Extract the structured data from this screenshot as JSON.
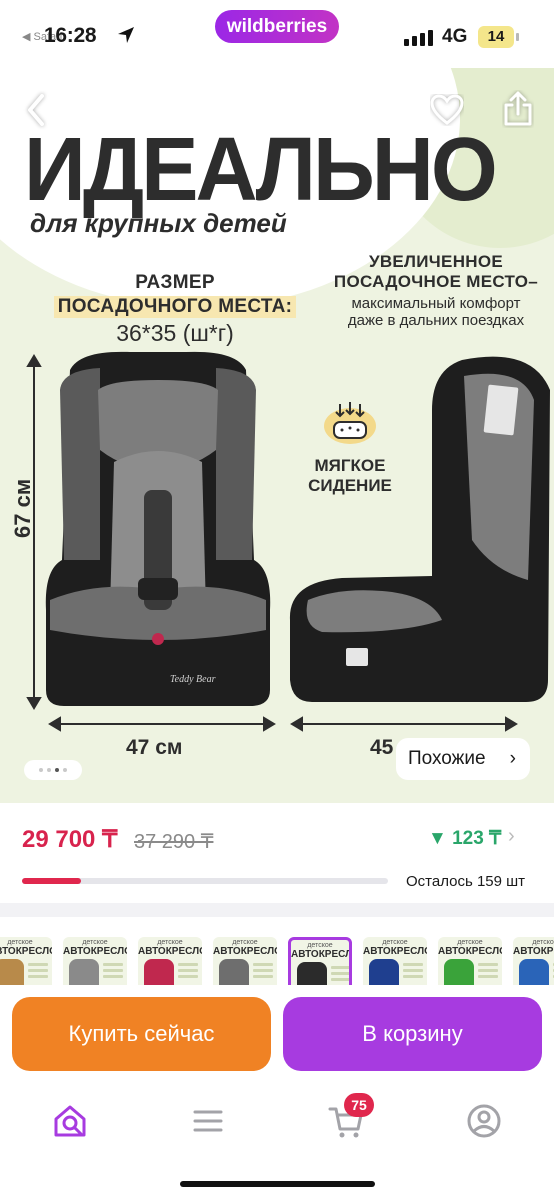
{
  "status_bar": {
    "time": "16:28",
    "back_app": "◀ Safari",
    "network": "4G",
    "battery": "14"
  },
  "brand": {
    "logo_text": "wildberries",
    "accent": "#a73be0"
  },
  "hero": {
    "title": "ИДЕАЛЬНО",
    "subtitle": "для крупных детей",
    "size_heading_1": "РАЗМЕР",
    "size_heading_2": "ПОСАДОЧНОГО МЕСТА:",
    "size_value": "36*35 (ш*г)",
    "seat_heading_1": "УВЕЛИЧЕННОЕ",
    "seat_heading_2": "ПОСАДОЧНОЕ МЕСТО–",
    "seat_desc_1": "максимальный комфорт",
    "seat_desc_2": "даже в дальних поездках",
    "soft_1": "МЯГКОЕ",
    "soft_2": "СИДЕНИЕ",
    "height": "67 см",
    "width_front": "47 см",
    "width_side": "45 см",
    "seat_brand": "Teddy Bear",
    "slide_index": 3,
    "slide_count": 4,
    "similar_label": "Похожие"
  },
  "price": {
    "current": "29 700 ₸",
    "old": "37 290 ₸",
    "cashback": "▼ 123 ₸",
    "stock_text": "Осталось 159 шт",
    "stock_fraction": 0.16
  },
  "variants": {
    "label_small": "детское",
    "label_big": "АВТОКРЕСЛО",
    "colors": [
      "#b88a4a",
      "#8a8a8a",
      "#c0284e",
      "#6e6e6e",
      "#2b2b2b",
      "#1f3f8f",
      "#3aa33a",
      "#2a64b8"
    ],
    "selected_index": 4
  },
  "actions": {
    "buy_now": "Купить сейчас",
    "add_to_cart": "В корзину"
  },
  "tabbar": {
    "cart_count": "75"
  }
}
